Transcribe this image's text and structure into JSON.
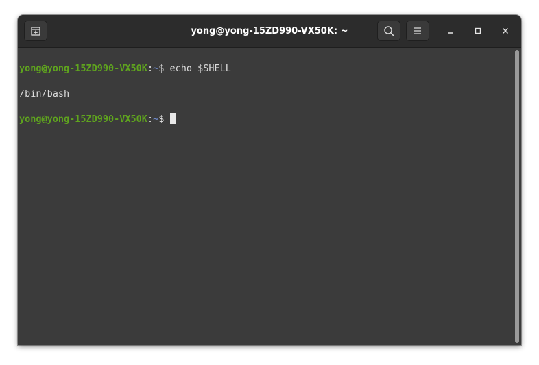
{
  "window": {
    "title": "yong@yong-15ZD990-VX50K: ~"
  },
  "headerbar": {
    "new_tab_icon": "new-tab-icon",
    "search_icon": "search-icon",
    "menu_icon": "hamburger-menu-icon",
    "minimize_icon": "minimize-icon",
    "maximize_icon": "maximize-icon",
    "close_icon": "close-icon"
  },
  "terminal": {
    "lines": [
      {
        "user": "yong@yong-15ZD990-VX50K",
        "sep": ":",
        "path": "~",
        "prompt": "$ ",
        "command": "echo $SHELL"
      },
      {
        "output": "/bin/bash"
      },
      {
        "user": "yong@yong-15ZD990-VX50K",
        "sep": ":",
        "path": "~",
        "prompt": "$ ",
        "command": ""
      }
    ]
  },
  "colors": {
    "user": "#5fa41e",
    "path": "#6c86c4",
    "text": "#dcdcdc",
    "background": "#3b3b3b",
    "headerbar": "#2c2c2c"
  }
}
